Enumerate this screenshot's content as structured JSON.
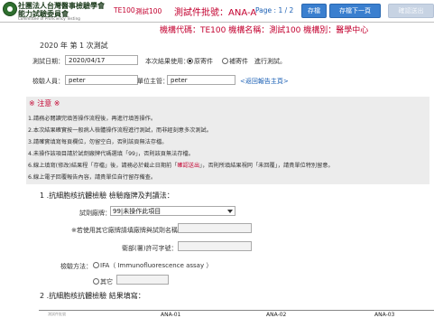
{
  "header": {
    "org_name_line1": "社團法人台灣醫事檢驗學會",
    "org_name_line2": "能力試驗委員會",
    "org_name_en": "Committee of Proficiency Testing",
    "code": "TE100",
    "test_name": "測試100",
    "title": "測試件批號：ANA-A",
    "page": "Page : 1 / 2",
    "buttons": {
      "save": "存檔",
      "save_next": "存檔下一頁",
      "submit": "確認送出"
    },
    "brand_color": "#c3002f",
    "button_color": "#3a7fcf"
  },
  "info": {
    "text": "機構代碼：TE100   機構名稱：測試100   機構別：醫學中心"
  },
  "form": {
    "year_line": "2020 年 第 1 次測試",
    "date_label": "測試日期：",
    "date_value": "2020/04/17",
    "usage_label": "本次結果使用：",
    "radio_original": "原寄件",
    "radio_resend": "補寄件",
    "usage_suffix": "進行測試。",
    "inspector_label": "檢驗人員：",
    "inspector_value": "peter",
    "supervisor_label": "單位主管：",
    "supervisor_value": "peter",
    "back_link": "<返回報告主頁>"
  },
  "notice": {
    "title": "※ 注意 ※",
    "items": [
      "1.請務必閱讀完填答操作流程後，再進行填答操作。",
      "2.本次結果確實按一般病人檢體操作流程進行測試，而非經刻意多次測試。",
      "3.請確實填寫每頁欄位，勿留空白，否則該頁無法存檔。",
      "4.未操作該項目請於試劑廠牌代碼選填「99」，否則該頁無法存檔。",
      "6.線上填寫(修改)結果程「存檔」後，請務必於截止日期前「",
      "確認送出",
      "」，否則所填結果視同「未回覆」，請貴單位特別留意。",
      "6.線上電子回覆報告內容，請貴單位自行留存備查。"
    ]
  },
  "section1": {
    "title": "1 .抗細胞核抗體檢驗 檢驗廠牌及判讀法：",
    "reagent_label": "試劑廠牌：",
    "reagent_value": "99|未操作此項目",
    "other_brand_label": "※若使用其它廠牌請填廠牌與試劑名稱：",
    "permit_label": "衛部(署)許可字號：",
    "method_label": "檢驗方法：",
    "method_ifa": "IFA（ Immunofluorescence assay ）",
    "method_other": "其它"
  },
  "section2": {
    "title": "2 .抗細胞核抗體檢驗 結果填寫：",
    "headers": [
      "測試件批號",
      "ANA-01",
      "ANA-02",
      "ANA-03"
    ]
  }
}
